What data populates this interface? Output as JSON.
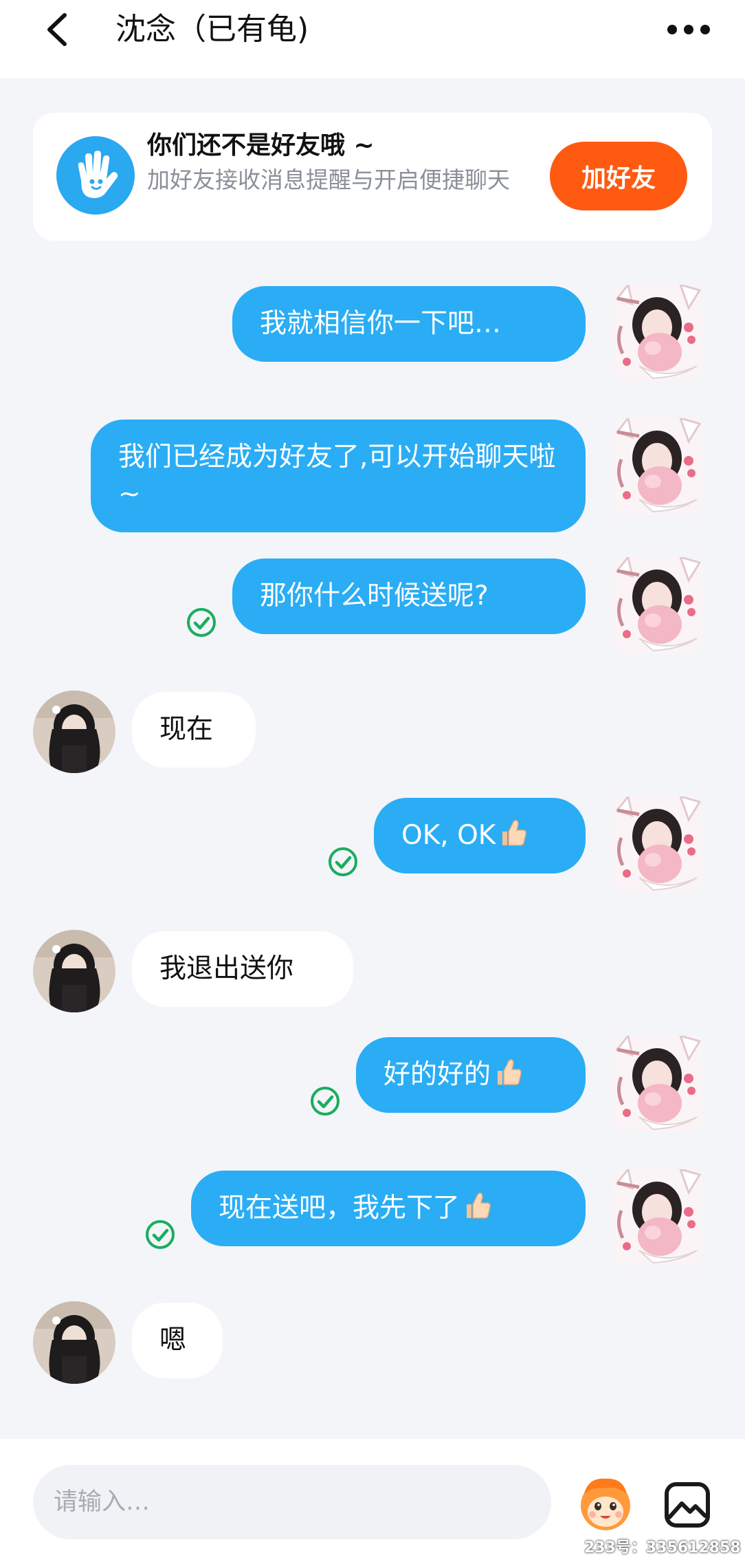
{
  "header": {
    "title": "沈念（已有龟)",
    "back_icon": "chevron-left-icon",
    "more_icon": "more-horizontal-icon"
  },
  "friend_banner": {
    "title": "你们还不是好友哦 ~",
    "subtitle": "加好友接收消息提醒与开启便捷聊天",
    "button_label": "加好友",
    "icon": "waving-hand-icon",
    "button_color": "#ff5a12"
  },
  "messages": [
    {
      "from": "me",
      "text": "我就相信你一下吧…",
      "read": false
    },
    {
      "from": "me",
      "text": "我们已经成为好友了,可以开始聊天啦~",
      "read": false
    },
    {
      "from": "me",
      "text": "那你什么时候送呢?",
      "read": true
    },
    {
      "from": "other",
      "text": "现在"
    },
    {
      "from": "me",
      "text": "OK, OK",
      "emoji": "thumbs-up-icon",
      "read": true
    },
    {
      "from": "other",
      "text": "我退出送你"
    },
    {
      "from": "me",
      "text": "好的好的",
      "emoji": "thumbs-up-icon",
      "read": true
    },
    {
      "from": "me",
      "text": "现在送吧，我先下了",
      "emoji": "thumbs-up-icon",
      "read": true
    },
    {
      "from": "other",
      "text": "嗯"
    }
  ],
  "input": {
    "placeholder": "请输入…",
    "sticker_icon": "sticker-face-icon",
    "image_icon": "image-icon"
  },
  "watermark": "233号：335612858",
  "colors": {
    "my_bubble": "#2aadf5",
    "other_bubble": "#ffffff",
    "read_check": "#1aad5e",
    "background": "#f3f5f9"
  }
}
